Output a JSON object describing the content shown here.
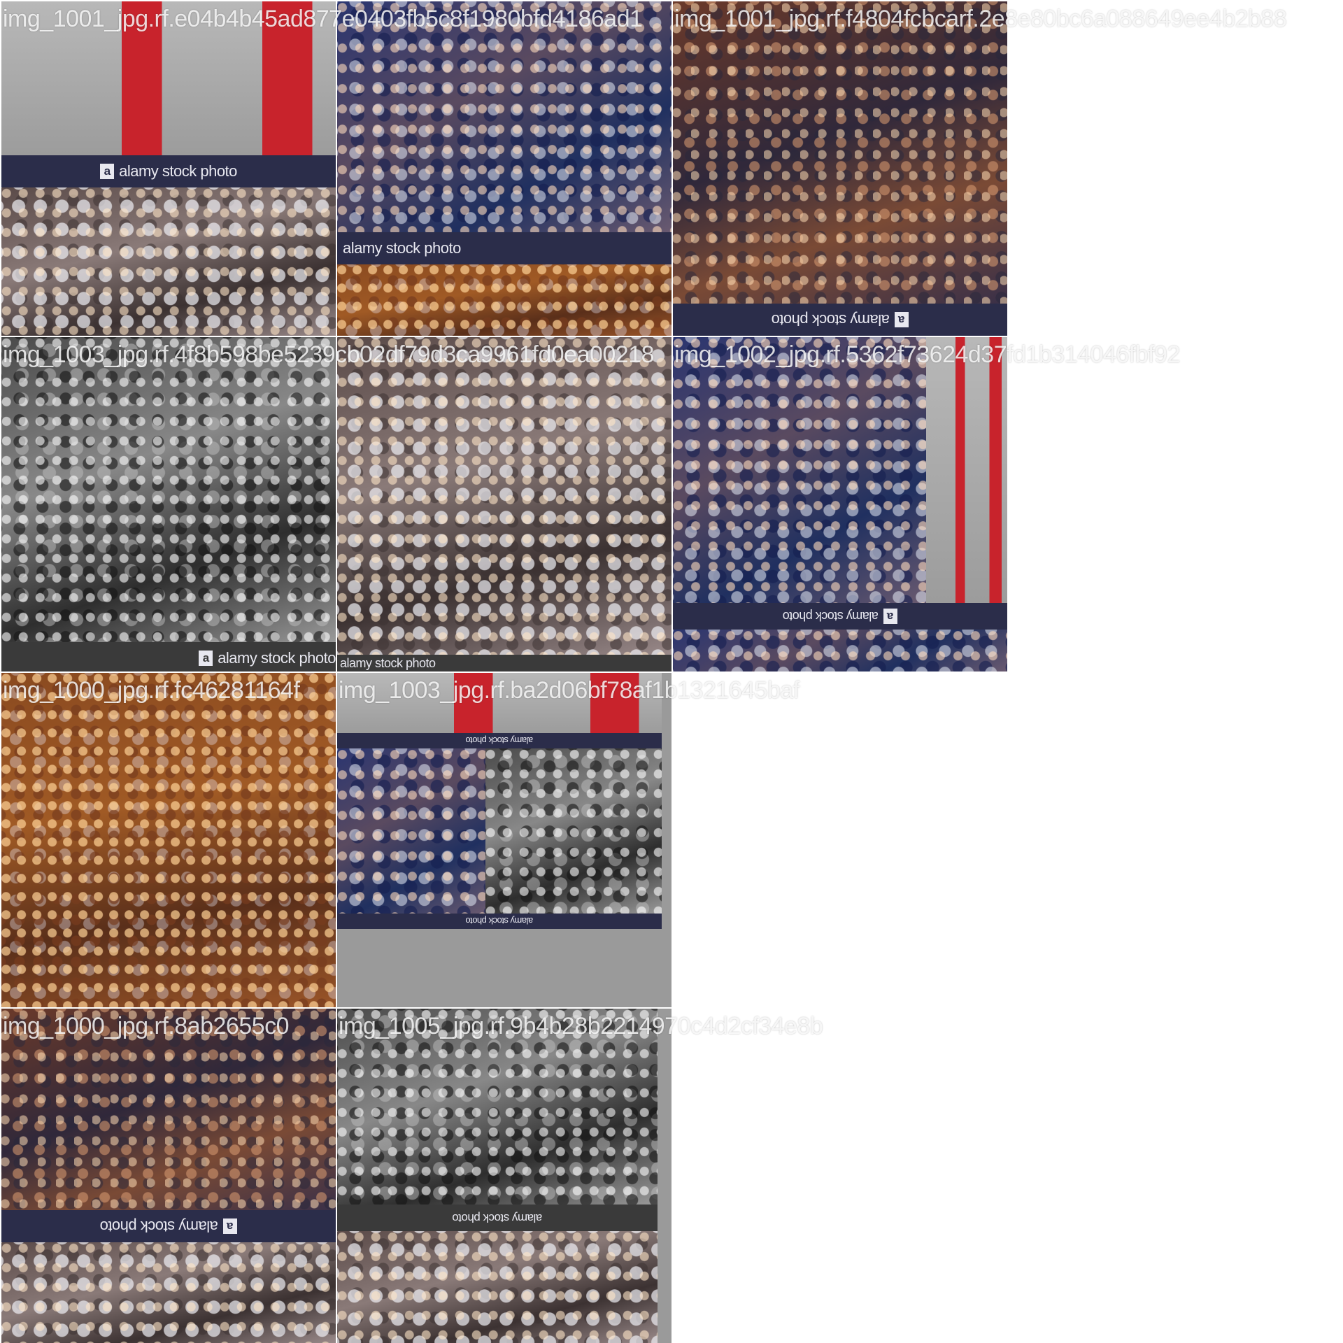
{
  "tiles": [
    {
      "label": "img_1001_jpg.rf.e04b4b45ad877e0403fb5c8f1980bfd4186ad1"
    },
    {
      "label": "img_1003_jpg.rf.4f8b598be5239cb02df79d3ca9961fd0ea00218"
    },
    {
      "label": "img_1000_jpg.rf.fc46281164f"
    },
    {
      "label": "img_1000_jpg.rf.8ab2655c0"
    },
    {
      "label": "img_1001_jpg.rf.f4804fcbcarf.2e8e80bc6a088649ee4b2b88"
    },
    {
      "label": "img_1002_jpg.rf.5362f73624d37fd1b314046fbf92"
    },
    {
      "label": "img_1003_jpg.rf.ba2d06bf78af1b1321645baf"
    },
    {
      "label": "img_1005_jpg.rf.9b4b28b2214970c4d2cf34e8b"
    }
  ],
  "watermark": {
    "logo": "a",
    "text": "alamy stock photo"
  }
}
